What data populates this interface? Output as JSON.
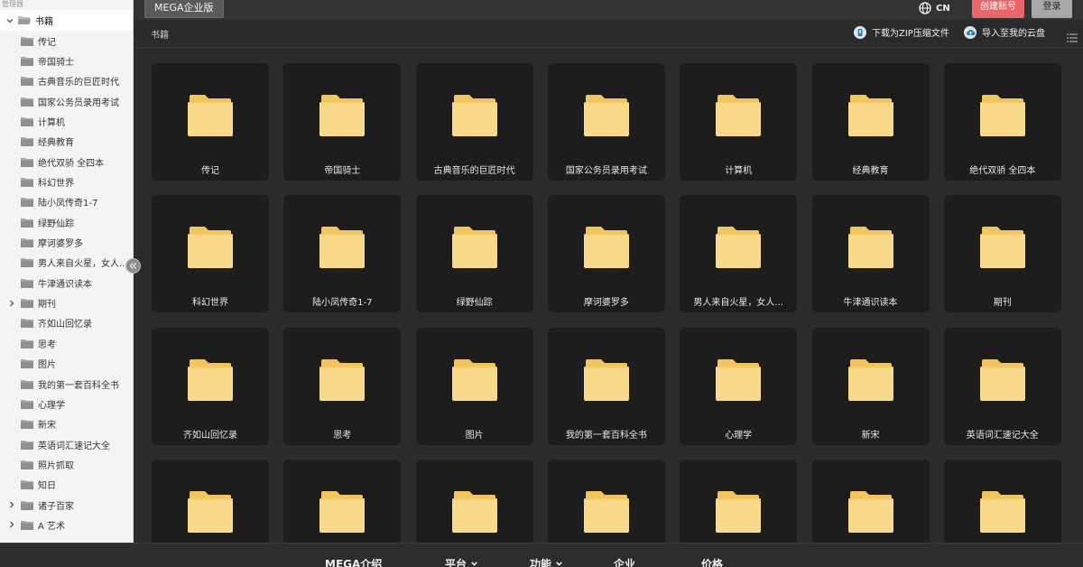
{
  "sidebar": {
    "header": "管理器",
    "root": "书籍",
    "items": [
      {
        "label": "传记",
        "expandable": false
      },
      {
        "label": "帝国骑士",
        "expandable": false
      },
      {
        "label": "古典音乐的巨匠时代",
        "expandable": false
      },
      {
        "label": "国家公务员录用考试",
        "expandable": false
      },
      {
        "label": "计算机",
        "expandable": false
      },
      {
        "label": "经典教育",
        "expandable": false
      },
      {
        "label": "绝代双骄 全四本",
        "expandable": false
      },
      {
        "label": "科幻世界",
        "expandable": false
      },
      {
        "label": "陆小凤传奇1-7",
        "expandable": false
      },
      {
        "label": "绿野仙踪",
        "expandable": false
      },
      {
        "label": "摩诃婆罗多",
        "expandable": false
      },
      {
        "label": "男人来自火星，女人...",
        "expandable": false
      },
      {
        "label": "牛津通识读本",
        "expandable": false
      },
      {
        "label": "期刊",
        "expandable": true
      },
      {
        "label": "齐如山回忆录",
        "expandable": false
      },
      {
        "label": "思考",
        "expandable": false
      },
      {
        "label": "图片",
        "expandable": false
      },
      {
        "label": "我的第一套百科全书",
        "expandable": false
      },
      {
        "label": "心理学",
        "expandable": false
      },
      {
        "label": "新宋",
        "expandable": false
      },
      {
        "label": "英语词汇速记大全",
        "expandable": false
      },
      {
        "label": "照片抓取",
        "expandable": false
      },
      {
        "label": "知日",
        "expandable": false
      },
      {
        "label": "诸子百家",
        "expandable": true
      },
      {
        "label": "A 艺术",
        "expandable": true
      }
    ]
  },
  "topbar": {
    "enterprise_label": "MEGA企业版",
    "language": "CN",
    "create_account": "创建账号",
    "login": "登录"
  },
  "breadcrumb": "书籍",
  "actions": {
    "download_zip": "下载为ZIP压缩文件",
    "import_cloud": "导入至我的云盘"
  },
  "folders": [
    "传记",
    "帝国骑士",
    "古典音乐的巨匠时代",
    "国家公务员录用考试",
    "计算机",
    "经典教育",
    "绝代双骄 全四本",
    "科幻世界",
    "陆小凤传奇1-7",
    "绿野仙踪",
    "摩诃婆罗多",
    "男人来自火星，女人...",
    "牛津通识读本",
    "期刊",
    "齐如山回忆录",
    "思考",
    "图片",
    "我的第一套百科全书",
    "心理学",
    "新宋",
    "英语词汇速记大全",
    "",
    "",
    "",
    "",
    "",
    "",
    ""
  ],
  "footer": {
    "nav": [
      {
        "label": "MEGA介绍",
        "dropdown": false
      },
      {
        "label": "平台",
        "dropdown": true
      },
      {
        "label": "功能",
        "dropdown": true
      },
      {
        "label": "企业",
        "dropdown": false
      },
      {
        "label": "价格",
        "dropdown": false
      }
    ]
  },
  "colors": {
    "folder_body": "#f9da8a",
    "folder_tab": "#f3c65c",
    "tile_bg": "#1d1d1d",
    "create_red": "#e9676a"
  }
}
